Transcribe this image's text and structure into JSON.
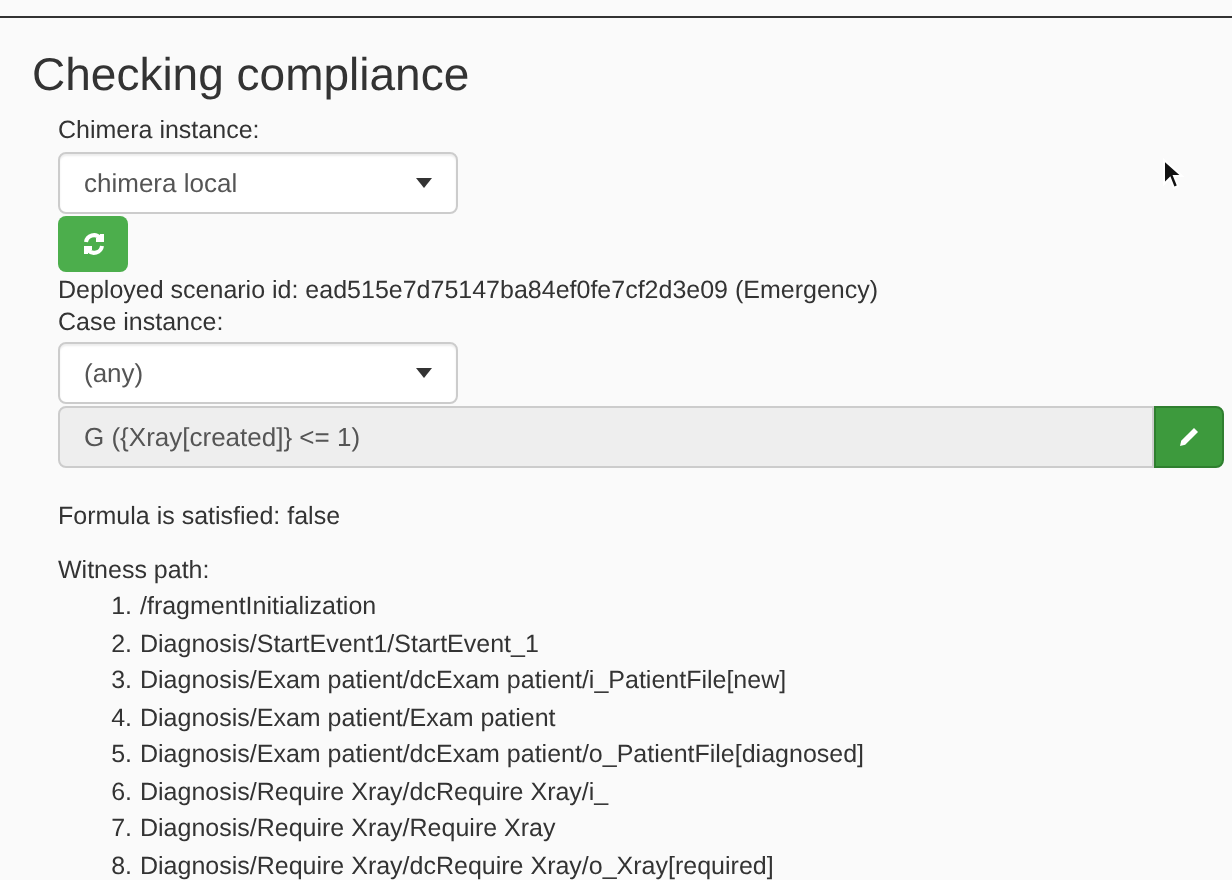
{
  "title": "Checking compliance",
  "chimera": {
    "label": "Chimera instance:",
    "value": "chimera local"
  },
  "deployed": "Deployed scenario id: ead515e7d75147ba84ef0fe7cf2d3e09 (Emergency)",
  "case": {
    "label": "Case instance:",
    "value": "(any)"
  },
  "formula": {
    "value": "G ({Xray[created]} <= 1)",
    "disabled": true
  },
  "result": "Formula is satisfied: false",
  "witness": {
    "label": "Witness path:",
    "steps": [
      {
        "number": "1.",
        "text": "/fragmentInitialization"
      },
      {
        "number": "2.",
        "text": "Diagnosis/StartEvent1/StartEvent_1"
      },
      {
        "number": "3.",
        "text": "Diagnosis/Exam patient/dcExam patient/i_PatientFile[new]"
      },
      {
        "number": "4.",
        "text": "Diagnosis/Exam patient/Exam patient"
      },
      {
        "number": "5.",
        "text": "Diagnosis/Exam patient/dcExam patient/o_PatientFile[diagnosed]"
      },
      {
        "number": "6.",
        "text": "Diagnosis/Require Xray/dcRequire Xray/i_"
      },
      {
        "number": "7.",
        "text": "Diagnosis/Require Xray/Require Xray"
      },
      {
        "number": "8.",
        "text": "Diagnosis/Require Xray/dcRequire Xray/o_Xray[required]"
      }
    ]
  }
}
